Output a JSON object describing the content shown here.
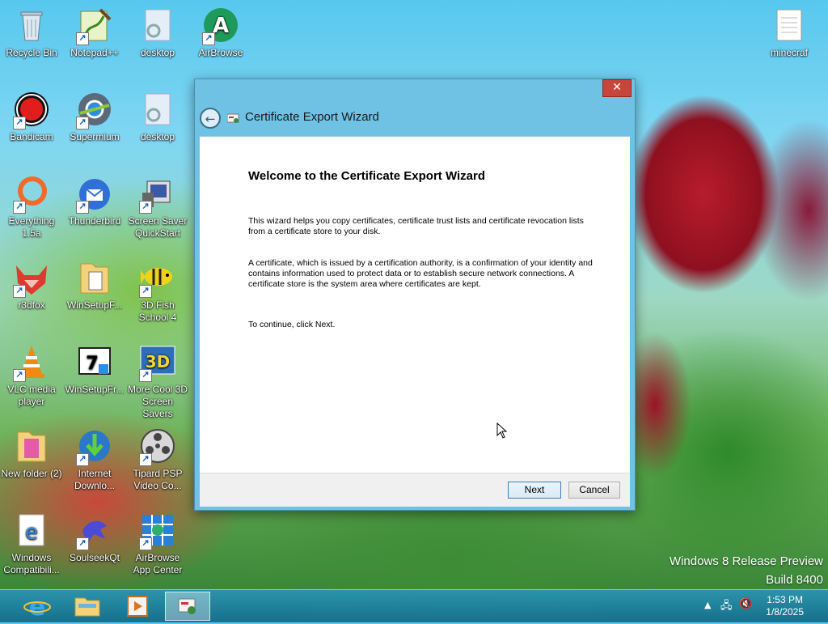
{
  "desktop": {
    "icons": [
      {
        "label": "Recycle Bin"
      },
      {
        "label": "Notepad++"
      },
      {
        "label": "desktop"
      },
      {
        "label": "AirBrowse"
      },
      {
        "label": "minecraf"
      },
      {
        "label": "Bandicam"
      },
      {
        "label": "Supermium"
      },
      {
        "label": "desktop"
      },
      {
        "label": "Everything 1.5a"
      },
      {
        "label": "Thunderbird"
      },
      {
        "label": "Screen Saver QuickStart"
      },
      {
        "label": "r3dfox"
      },
      {
        "label": "WinSetupF..."
      },
      {
        "label": "3D Fish School 4"
      },
      {
        "label": "VLC media player"
      },
      {
        "label": "WinSetupFr..."
      },
      {
        "label": "More Cool 3D Screen Savers"
      },
      {
        "label": "New folder (2)"
      },
      {
        "label": "Internet Downlo..."
      },
      {
        "label": "Tipard PSP Video Co..."
      },
      {
        "label": "Windows Compatibili..."
      },
      {
        "label": "SoulseekQt"
      },
      {
        "label": "AirBrowse App Center"
      }
    ],
    "watermark_line1": "Windows 8 Release Preview",
    "watermark_line2": "Build 8400"
  },
  "dialog": {
    "title": "Certificate Export Wizard",
    "close_label": "✕",
    "heading": "Welcome to the Certificate Export Wizard",
    "para1": "This wizard helps you copy certificates, certificate trust lists and certificate revocation lists from a certificate store to your disk.",
    "para2": "A certificate, which is issued by a certification authority, is a confirmation of your identity and contains information used to protect data or to establish secure network connections. A certificate store is the system area where certificates are kept.",
    "para3": "To continue, click Next.",
    "next_label": "Next",
    "cancel_label": "Cancel"
  },
  "taskbar": {
    "items": [
      {
        "icon": "internet-explorer-icon"
      },
      {
        "icon": "file-explorer-icon"
      },
      {
        "icon": "media-player-icon"
      },
      {
        "icon": "certificate-wizard-icon",
        "active": true
      }
    ],
    "time": "1:53 PM",
    "date": "1/8/2025"
  },
  "colors": {
    "accent": "#6fc2e4",
    "close_red": "#c7453a"
  }
}
